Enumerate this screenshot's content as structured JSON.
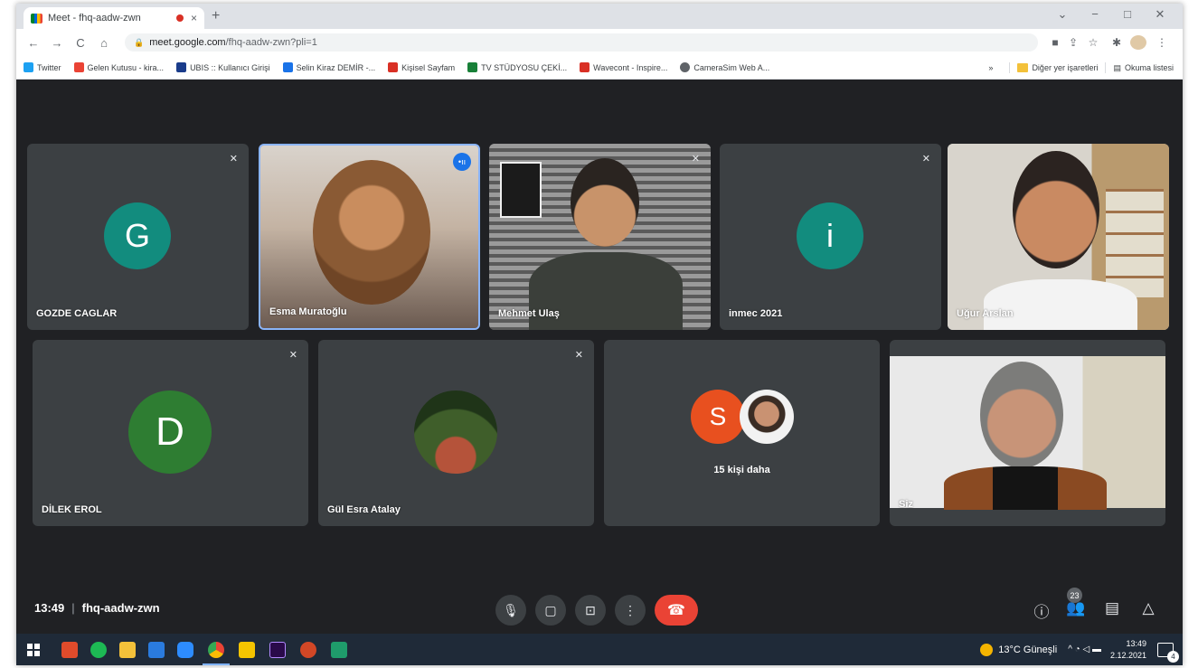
{
  "browser": {
    "tab_title": "Meet - fhq-aadw-zwn",
    "tab_close": "×",
    "new_tab": "+",
    "url_host": "meet.google.com",
    "url_path": "/fhq-aadw-zwn?pli=1",
    "window_controls": {
      "minimize": "−",
      "maximize": "□",
      "close": "✕",
      "chevron": "⌄"
    },
    "nav": {
      "back": "←",
      "forward": "→",
      "reload": "C",
      "home": "⌂"
    },
    "bookmarks": [
      {
        "label": "Twitter",
        "color": "#1da1f2"
      },
      {
        "label": "Gelen Kutusu - kira...",
        "color": "#ea4335"
      },
      {
        "label": "UBIS :: Kullanıcı Girişi",
        "color": "#1a3c8b"
      },
      {
        "label": "Selin Kiraz DEMİR -...",
        "color": "#1a73e8"
      },
      {
        "label": "Kişisel Sayfam",
        "color": "#d93025"
      },
      {
        "label": "TV STÜDYOSU ÇEKİ...",
        "color": "#188038"
      },
      {
        "label": "Wavecont - Inspire...",
        "color": "#d93025"
      },
      {
        "label": "CameraSim Web A...",
        "color": "#5f6368"
      }
    ],
    "bookmarks_more": "»",
    "other_bookmarks": "Diğer yer işaretleri",
    "reading_list": "Okuma listesi"
  },
  "meet": {
    "tiles": [
      {
        "name": "GOZDE CAGLAR",
        "initial": "G",
        "avatar_color": "#128c7e",
        "muted": true,
        "type": "avatar"
      },
      {
        "name": "Esma Muratoğlu",
        "muted": false,
        "speaking": true,
        "type": "video"
      },
      {
        "name": "Mehmet Ulaş",
        "muted": true,
        "type": "video"
      },
      {
        "name": "inmec 2021",
        "initial": "i",
        "avatar_color": "#128c7e",
        "muted": true,
        "type": "avatar"
      },
      {
        "name": "Uğur Arslan",
        "muted": false,
        "type": "video"
      },
      {
        "name": "DİLEK EROL",
        "initial": "D",
        "avatar_color": "#2e7d32",
        "muted": true,
        "type": "avatar"
      },
      {
        "name": "Gül Esra Atalay",
        "muted": true,
        "type": "photo"
      },
      {
        "name": "15 kişi daha",
        "initial": "S",
        "avatar_color": "#e8501f",
        "type": "others"
      },
      {
        "name": "Siz",
        "muted": false,
        "type": "video"
      }
    ],
    "mute_icon": "✕",
    "speaking_icon": "•ıı",
    "time": "13:49",
    "separator": "|",
    "meeting_code": "fhq-aadw-zwn",
    "participant_count": "23",
    "controls": {
      "mic": "🎙",
      "camera": "▢",
      "present": "⊡",
      "more": "⋮",
      "end": "☎"
    },
    "side": {
      "info": "ⓘ",
      "people": "👥",
      "chat": "▤",
      "activities": "△"
    }
  },
  "taskbar": {
    "weather": "13°C Güneşli",
    "time": "13:49",
    "date": "2.12.2021",
    "notifications": "4",
    "tray_icons": "^ ◔ ◁ ▬",
    "apps": [
      {
        "name": "windows",
        "color": "#ffffff"
      },
      {
        "name": "app-red",
        "color": "#e04b2b"
      },
      {
        "name": "spotify",
        "color": "#1db954"
      },
      {
        "name": "explorer",
        "color": "#f3c13a"
      },
      {
        "name": "mail",
        "color": "#2a7bde"
      },
      {
        "name": "zoom",
        "color": "#2d8cff"
      },
      {
        "name": "chrome",
        "color": "#4285f4"
      },
      {
        "name": "app-yellow",
        "color": "#f5c400"
      },
      {
        "name": "premiere",
        "color": "#2a0a4a"
      },
      {
        "name": "powerpoint",
        "color": "#d24726"
      },
      {
        "name": "app-green",
        "color": "#1f9c6b"
      }
    ]
  }
}
